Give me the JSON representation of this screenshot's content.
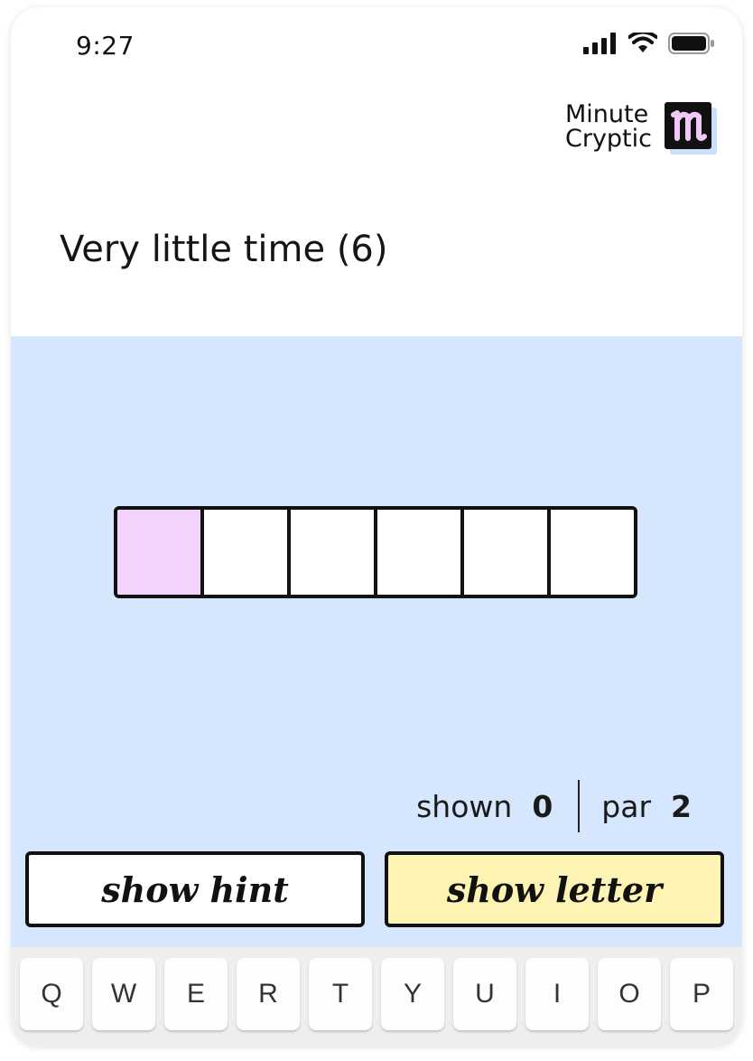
{
  "status_bar": {
    "time": "9:27",
    "icons": [
      "signal-icon",
      "wifi-icon",
      "battery-icon"
    ]
  },
  "logo": {
    "line1": "Minute",
    "line2": "Cryptic",
    "mark": "m"
  },
  "clue": {
    "text": "Very little time (6)"
  },
  "grid": {
    "length": 6,
    "active_index": 0
  },
  "counters": {
    "shown_label": "shown",
    "shown_value": "0",
    "par_label": "par",
    "par_value": "2"
  },
  "buttons": {
    "hint": "show hint",
    "letter": "show letter"
  },
  "keyboard": {
    "keys": [
      "Q",
      "W",
      "E",
      "R",
      "T",
      "Y",
      "U",
      "I",
      "O",
      "P"
    ]
  },
  "colors": {
    "play_bg": "#d5e6fd",
    "active_cell": "#f2d3fb",
    "letter_button": "#fdf3b2"
  }
}
